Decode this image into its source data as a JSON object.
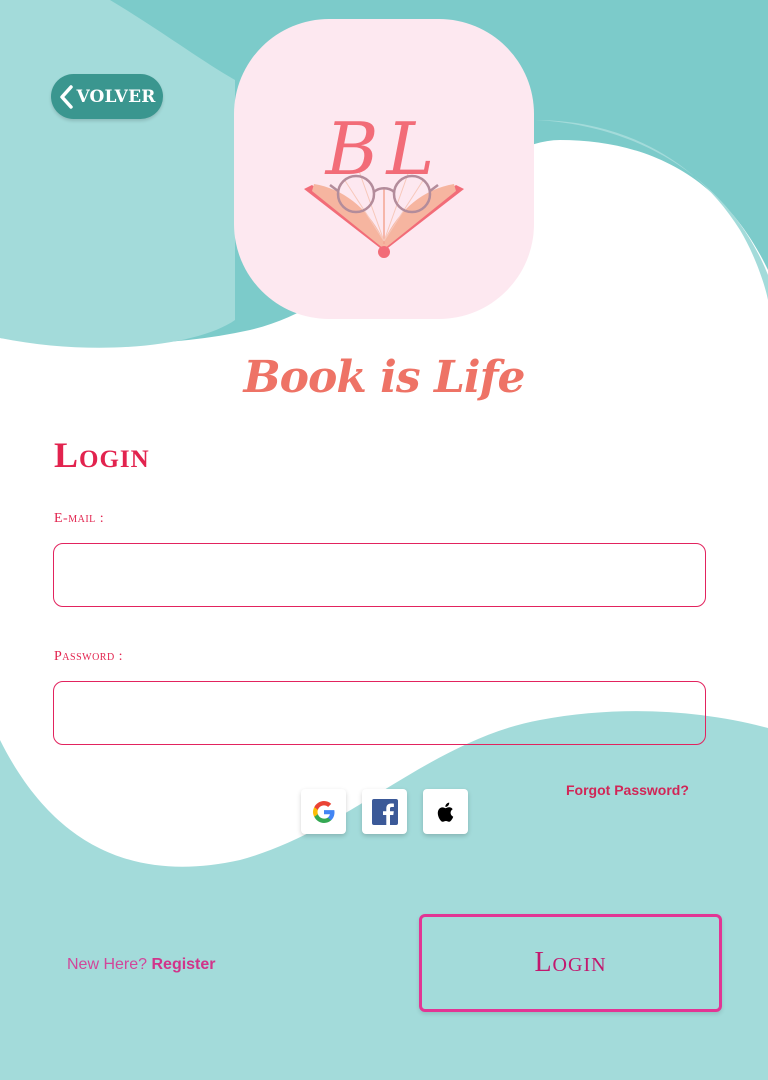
{
  "colors": {
    "teal_dark": "#7ccbca",
    "teal_light": "#a3dbda",
    "back_button": "#3a968f",
    "logo_bg": "#fde8f0",
    "accent_red": "#e2234e",
    "accent_pink": "#e23594",
    "brand_coral": "#ee7366"
  },
  "header": {
    "back_label": "VOLVER",
    "back_icon": "chevron-left-icon"
  },
  "logo": {
    "initials": "BL",
    "icon": "open-book-with-glasses"
  },
  "brand": {
    "name": "Book is Life"
  },
  "form": {
    "title": "Login",
    "email_label": "E-mail :",
    "email_value": "",
    "password_label": "Password :",
    "password_value": "",
    "forgot_label": "Forgot Password?"
  },
  "social": {
    "providers": [
      {
        "name": "google",
        "icon": "google-icon"
      },
      {
        "name": "facebook",
        "icon": "facebook-icon"
      },
      {
        "name": "apple",
        "icon": "apple-icon"
      }
    ]
  },
  "footer": {
    "new_here": "New Here?",
    "register_label": "Register",
    "login_button": "Login"
  }
}
